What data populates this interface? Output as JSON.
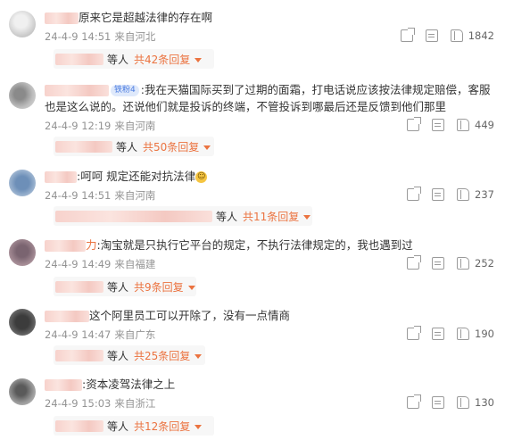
{
  "comments": [
    {
      "text": "原来它是超越法律的存在啊",
      "date": "24-4-9 14:51",
      "location": "来自河北",
      "likes": "1842",
      "replies_who": "等人",
      "replies_count": "共42条回复"
    },
    {
      "vip": "铁粉4",
      "text": ":我在天猫国际买到了过期的面霜，打电话说应该按法律规定赔偿，客服也是这么说的。还说他们就是投诉的终端，不管投诉到哪最后还是反馈到他们那里",
      "date": "24-4-9 12:19",
      "location": "来自河南",
      "likes": "449",
      "replies_who": "等人",
      "replies_count": "共50条回复"
    },
    {
      "text": ":呵呵 规定还能对抗法律",
      "date": "24-4-9 14:51",
      "location": "来自河南",
      "likes": "237",
      "replies_who": "等人",
      "replies_count": "共11条回复"
    },
    {
      "name_tail": "力",
      "text": ":淘宝就是只执行它平台的规定，不执行法律规定的，我也遇到过",
      "date": "24-4-9 14:49",
      "location": "来自福建",
      "likes": "252",
      "replies_who": "等人",
      "replies_count": "共9条回复"
    },
    {
      "text": "这个阿里员工可以开除了，没有一点情商",
      "date": "24-4-9 14:47",
      "location": "来自广东",
      "likes": "190",
      "replies_who": "等人",
      "replies_count": "共25条回复"
    },
    {
      "text": "资本凌驾法律之上",
      "date": "24-4-9 15:03",
      "location": "来自浙江",
      "likes": "130",
      "replies_who": "等人",
      "replies_count": "共12条回复"
    }
  ]
}
